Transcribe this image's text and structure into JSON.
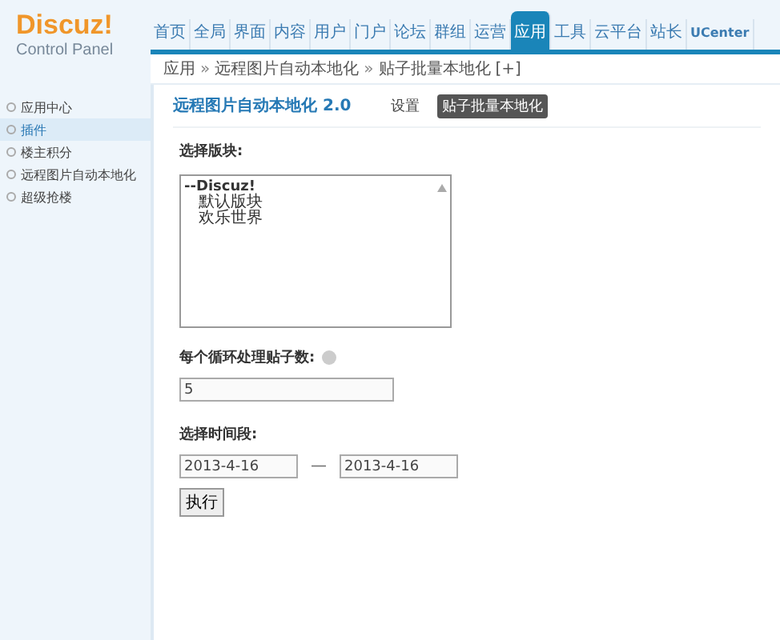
{
  "logo": {
    "title": "Discuz!",
    "subtitle": "Control Panel"
  },
  "nav": [
    {
      "label": "首页",
      "selected": false
    },
    {
      "label": "全局",
      "selected": false
    },
    {
      "label": "界面",
      "selected": false
    },
    {
      "label": "内容",
      "selected": false
    },
    {
      "label": "用户",
      "selected": false
    },
    {
      "label": "门户",
      "selected": false
    },
    {
      "label": "论坛",
      "selected": false
    },
    {
      "label": "群组",
      "selected": false
    },
    {
      "label": "运营",
      "selected": false
    },
    {
      "label": "应用",
      "selected": true
    },
    {
      "label": "工具",
      "selected": false
    },
    {
      "label": "云平台",
      "selected": false
    },
    {
      "label": "站长",
      "selected": false
    },
    {
      "label": "UCenter",
      "selected": false
    }
  ],
  "breadcrumb": {
    "items": [
      "应用",
      "远程图片自动本地化",
      "贴子批量本地化"
    ],
    "separator": "»",
    "add": "[+]"
  },
  "sidebar": {
    "items": [
      {
        "label": "应用中心",
        "selected": false
      },
      {
        "label": "插件",
        "selected": true
      },
      {
        "label": "楼主积分",
        "selected": false
      },
      {
        "label": "远程图片自动本地化",
        "selected": false
      },
      {
        "label": "超级抢楼",
        "selected": false
      }
    ]
  },
  "heading": {
    "title": "远程图片自动本地化 2.0",
    "tabs": [
      {
        "label": "设置",
        "selected": false
      },
      {
        "label": "贴子批量本地化",
        "selected": true
      }
    ]
  },
  "form": {
    "forum_label": "选择版块:",
    "forums": [
      {
        "label": "--Discuz!",
        "children": [
          {
            "label": "默认版块"
          },
          {
            "label": "欢乐世界"
          }
        ]
      }
    ],
    "count_label": "每个循环处理贴子数:",
    "count_value": "5",
    "period_label": "选择时间段:",
    "date_from": "2013-4-16",
    "date_sep": "—",
    "date_to": "2013-4-16",
    "submit": "执行"
  }
}
